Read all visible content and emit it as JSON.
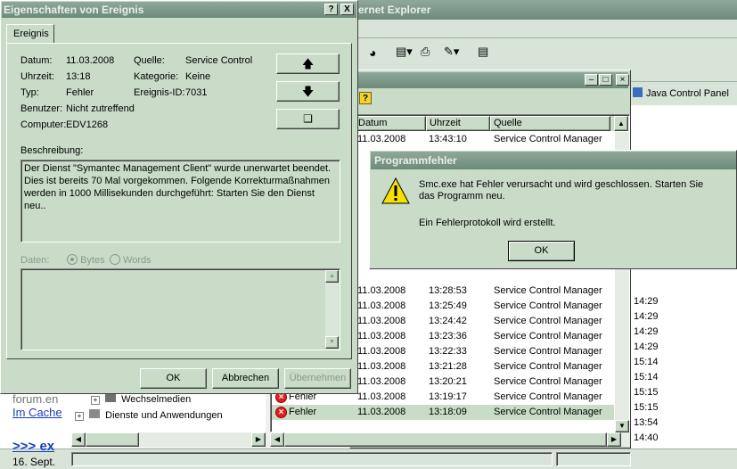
{
  "ie": {
    "title_fragment": "ernet Explorer",
    "links_item": "Java Control Panel",
    "times": [
      "14:29",
      "14:29",
      "14:29",
      "14:29",
      "15:14",
      "15:14",
      "15:15",
      "15:15",
      "13:54",
      "14:40"
    ]
  },
  "left_page": {
    "text1": "forum.en",
    "link1": "Im Cache",
    "heading": ">>> ex",
    "date": "16. Sept."
  },
  "event_viewer": {
    "columns": {
      "date": "Datum",
      "time": "Uhrzeit",
      "source": "Quelle"
    },
    "rows": [
      {
        "type": "",
        "date": "11.03.2008",
        "time": "13:43:10",
        "source": "Service Control Manager"
      },
      {
        "type": "",
        "date": "11.03.2008",
        "time": "13:28:53",
        "source": "Service Control Manager"
      },
      {
        "type": "",
        "date": "11.03.2008",
        "time": "13:25:49",
        "source": "Service Control Manager"
      },
      {
        "type": "",
        "date": "11.03.2008",
        "time": "13:24:42",
        "source": "Service Control Manager"
      },
      {
        "type": "",
        "date": "11.03.2008",
        "time": "13:23:36",
        "source": "Service Control Manager"
      },
      {
        "type": "",
        "date": "11.03.2008",
        "time": "13:22:33",
        "source": "Service Control Manager"
      },
      {
        "type": "",
        "date": "11.03.2008",
        "time": "13:21:28",
        "source": "Service Control Manager"
      },
      {
        "type": "",
        "date": "11.03.2008",
        "time": "13:20:21",
        "source": "Service Control Manager"
      },
      {
        "type": "Fehler",
        "date": "11.03.2008",
        "time": "13:19:17",
        "source": "Service Control Manager"
      },
      {
        "type": "Fehler",
        "date": "11.03.2008",
        "time": "13:18:09",
        "source": "Service Control Manager"
      }
    ],
    "tree": [
      "Wechselmedien",
      "Dienste und Anwendungen"
    ]
  },
  "properties": {
    "title": "Eigenschaften von Ereignis",
    "title_help": "?",
    "title_close": "X",
    "tab": "Ereignis",
    "labels": {
      "date": "Datum:",
      "time": "Uhrzeit:",
      "type": "Typ:",
      "user": "Benutzer:",
      "computer": "Computer:",
      "source": "Quelle:",
      "category": "Kategorie:",
      "event_id": "Ereignis-ID:"
    },
    "values": {
      "date": "11.03.2008",
      "time": "13:18",
      "type": "Fehler",
      "user": "Nicht zutreffend",
      "computer": "EDV1268",
      "source": "Service Control",
      "category": "Keine",
      "event_id": "7031"
    },
    "description_label": "Beschreibung:",
    "description": "Der Dienst \"Symantec Management Client\" wurde unerwartet beendet. Dies ist bereits 70 Mal vorgekommen. Folgende Korrekturmaßnahmen werden in 1000 Millisekunden durchgeführt: Starten Sie den Dienst neu..",
    "data_label": "Daten:",
    "radio_bytes": "Bytes",
    "radio_words": "Words",
    "ok": "OK",
    "cancel": "Abbrechen",
    "apply": "Übernehmen"
  },
  "error_dialog": {
    "title": "Programmfehler",
    "message": "Smc.exe hat Fehler verursacht und wird geschlossen. Starten Sie das Programm neu.",
    "sub": "Ein Fehlerprotokoll wird erstellt.",
    "ok": "OK"
  },
  "colors": {
    "accent": "#c8dcc8",
    "title": "#7a9584"
  }
}
